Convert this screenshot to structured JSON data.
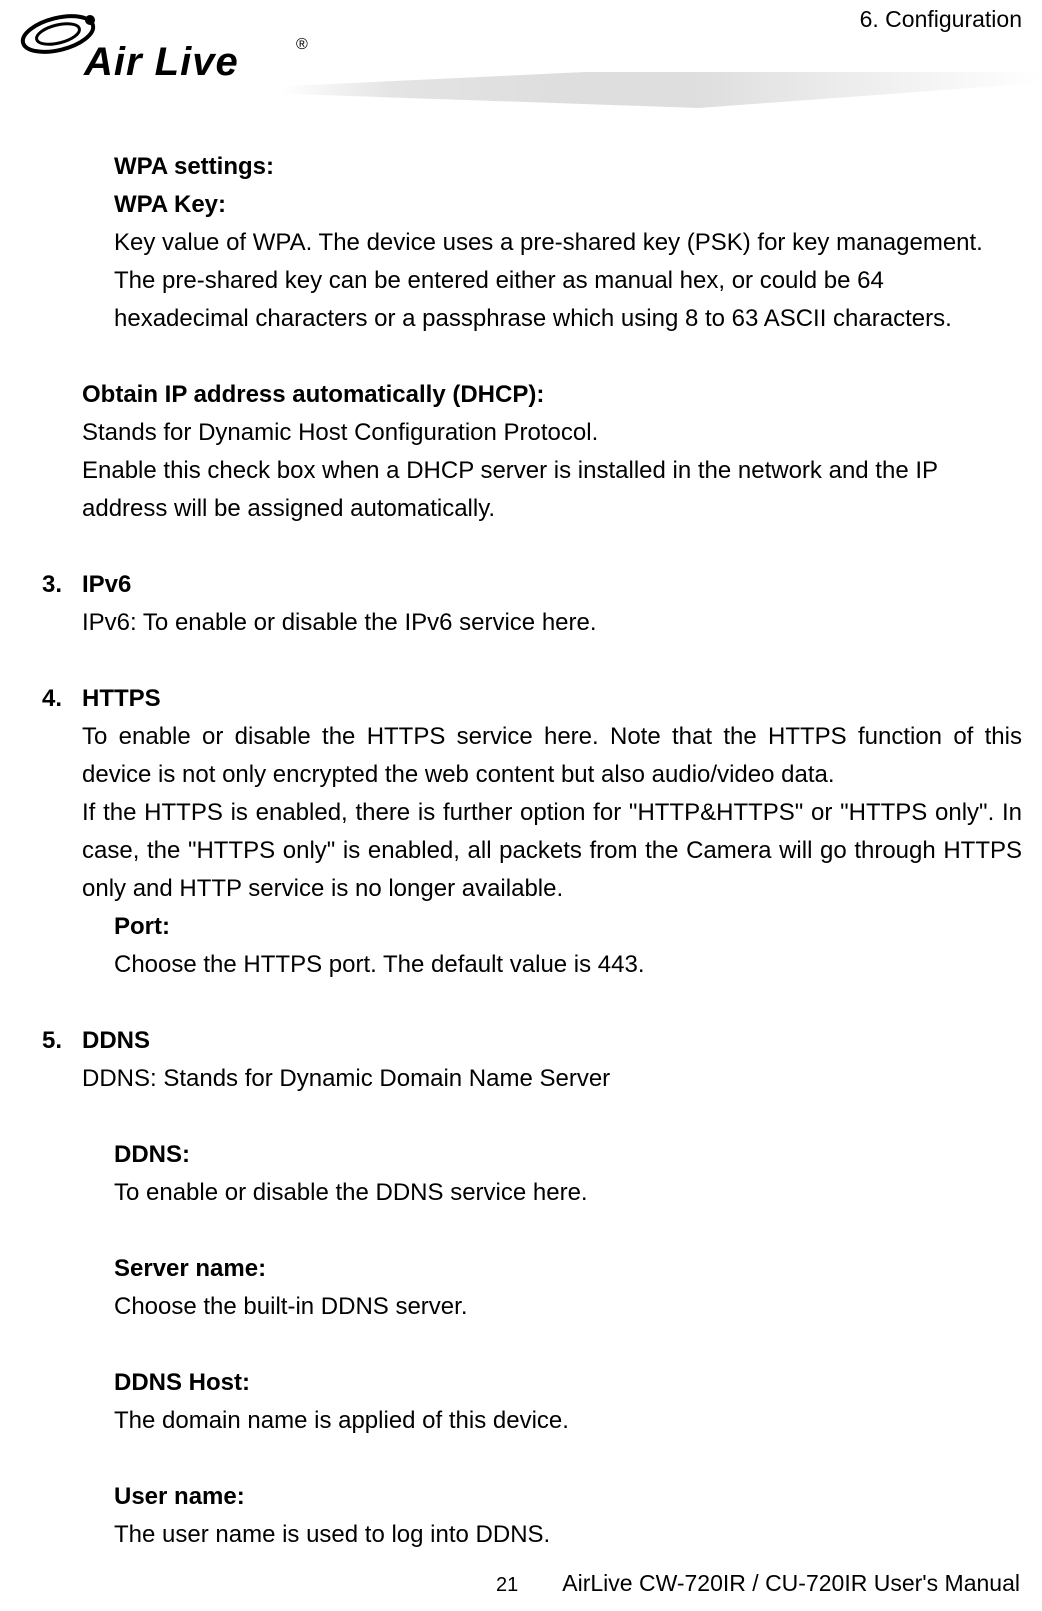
{
  "header": {
    "section": "6.  Configuration",
    "logo_text": "Air Live",
    "logo_reg": "®"
  },
  "footer": {
    "page_number": "21",
    "text": "AirLive CW-720IR / CU-720IR User's Manual"
  },
  "c": {
    "wpa_settings": "WPA settings:",
    "wpa_key": "WPA Key:",
    "wpa_key_desc": "Key value of WPA. The device uses a pre-shared key (PSK) for key management. The pre-shared key can be entered either as manual hex, or could be 64 hexadecimal characters or a passphrase which using 8 to 63 ASCII characters.",
    "dhcp_h": "Obtain IP address automatically (DHCP):",
    "dhcp_l1": "Stands for Dynamic Host Configuration Protocol.",
    "dhcp_l2": "Enable this check box when a DHCP server is installed in the network and the IP address will be assigned automatically.",
    "s3_num": "3.",
    "s3_h": "IPv6",
    "s3_t": "IPv6: To enable or disable the IPv6 service here.",
    "s4_num": "4.",
    "s4_h": "HTTPS",
    "s4_p1": "To enable or disable the HTTPS service here. Note that the HTTPS function of this device is not only encrypted the web content but also audio/video data.",
    "s4_p2": "If the HTTPS is enabled, there is further option for \"HTTP&HTTPS\" or \"HTTPS only\". In case, the \"HTTPS only\" is enabled, all packets from the Camera will go through HTTPS only and HTTP service is no longer available.",
    "port_h": "Port:",
    "port_t": "Choose the HTTPS port. The default value is 443.",
    "s5_num": "5.",
    "s5_h": "DDNS",
    "s5_t": "DDNS: Stands for Dynamic Domain Name Server",
    "ddns_h": "DDNS:",
    "ddns_t": "To enable or disable the DDNS service here.",
    "server_h": "Server name:",
    "server_t": "Choose the built-in DDNS server.",
    "host_h": "DDNS Host:",
    "host_t": "The domain name is applied of this device.",
    "user_h": "User name:",
    "user_t": "The user name is used to log into DDNS."
  }
}
